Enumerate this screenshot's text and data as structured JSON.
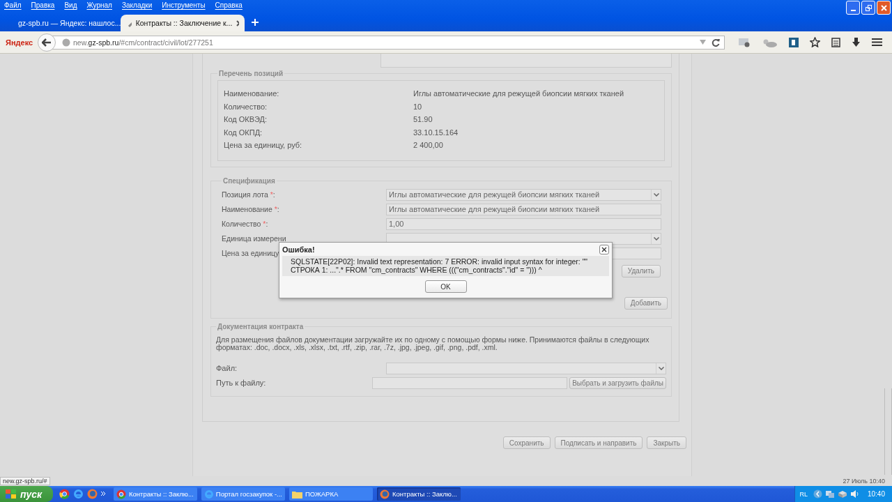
{
  "window": {
    "menu": [
      "Файл",
      "Правка",
      "Вид",
      "Журнал",
      "Закладки",
      "Инструменты",
      "Справка"
    ]
  },
  "tabs": [
    {
      "label": "gz-spb.ru — Яндекс: нашлос...",
      "selected": false
    },
    {
      "label": "Контракты :: Заключение к...",
      "selected": true
    }
  ],
  "toolbar": {
    "brand": "Яндекс",
    "address": "new.**gz-spb.ru**/#cm/contract/civil/lot/277251"
  },
  "positions": {
    "title": "Перечень позиций",
    "rows": [
      {
        "label": "Наименование:",
        "value": "Иглы автоматические для режущей биопсии мягких тканей"
      },
      {
        "label": "Количество:",
        "value": "10"
      },
      {
        "label": "Код ОКВЭД:",
        "value": "51.90"
      },
      {
        "label": "Код ОКПД:",
        "value": "33.10.15.164"
      },
      {
        "label": "Цена за единицу, руб:",
        "value": "2 400,00"
      }
    ]
  },
  "specification": {
    "title": "Спецификация",
    "fields": [
      {
        "label": "Позиция лота",
        "required_mark": "*",
        "colon": ":",
        "kind": "select",
        "value": "Иглы автоматические для режущей биопсии мягких тканей"
      },
      {
        "label": "Наименование",
        "required_mark": "*",
        "colon": ":",
        "kind": "text",
        "value": "Иглы автоматические для режущей биопсии мягких тканей"
      },
      {
        "label": "Количество",
        "required_mark": "*",
        "colon": ":",
        "kind": "text",
        "value": "1,00"
      },
      {
        "label": "Единица измерени",
        "kind": "select"
      },
      {
        "label": "Цена за единицу",
        "kind": "text"
      }
    ],
    "delete_button": "Удалить",
    "add_button": "Добавить"
  },
  "documents": {
    "title": "Документация контракта",
    "description": "Для размещения файлов документации загружайте их по одному с помощью формы ниже. Принимаются файлы в следующих форматах: .doc, .docx, .xls, .xlsx, .txt, .rtf, .zip, .rar, .7z, .jpg, .jpeg, .gif, .png, .pdf, .xml.",
    "file_label": "Файл:",
    "path_label": "Путь к файлу:",
    "upload_button": "Выбрать и загрузить файлы"
  },
  "actions": [
    "Сохранить",
    "Подписать и направить",
    "Закрыть"
  ],
  "dialog": {
    "title": "Ошибка!",
    "message": "SQLSTATE[22P02]: Invalid text representation: 7 ERROR: invalid input syntax for integer: \"\" СТРОКА 1: ...\".* FROM \"cm_contracts\" WHERE (((\"cm_contracts\".\"id\" = ''))) ^",
    "ok": "OK"
  },
  "status_bar": {
    "url": "new.gz-spb.ru/#",
    "datetime": "27 Июль 10:40"
  },
  "taskbar": {
    "start": "пуск",
    "tasks": [
      {
        "label": "Контракты :: Заклю...",
        "selected": false,
        "kind": "chrome"
      },
      {
        "label": "Портал госзакупок -...",
        "selected": false,
        "kind": "ie"
      },
      {
        "label": "ПОЖАРКА",
        "selected": false,
        "kind": "folder"
      },
      {
        "label": "Контракты :: Заклю...",
        "selected": true,
        "kind": "firefox"
      }
    ],
    "language": "RL",
    "clock": "10:40"
  }
}
